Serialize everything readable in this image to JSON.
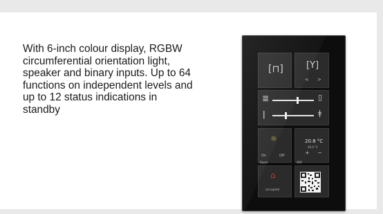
{
  "description": "With 6-inch colour display, RGBW circumferential orientation light, speaker and binary inputs. Up to 64 functions on independent levels and up to 12 status indications in standby",
  "device": {
    "light_tile": {
      "on_label": "On",
      "off_label": "Off"
    },
    "temperature_tile": {
      "value": "20.8 °C",
      "sub_value": "20.0 °C",
      "plus": "+",
      "minus": "−"
    },
    "status_tile": {
      "title": "Room",
      "state": "occupied"
    },
    "qr_tile": {
      "title": "WiFi"
    },
    "nav_tile": {
      "left": "<",
      "right": ">"
    }
  }
}
